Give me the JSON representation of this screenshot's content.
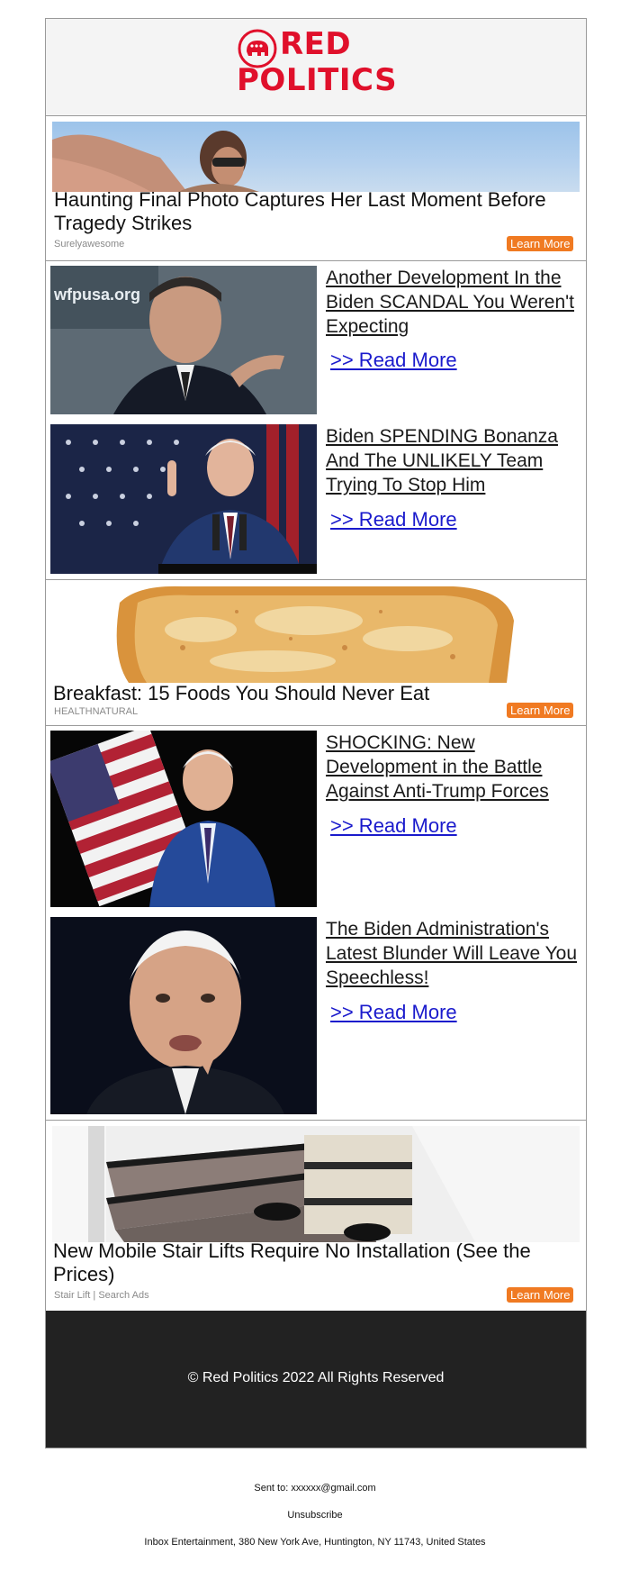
{
  "brand": {
    "line1": "RED",
    "line2": "POLITICS",
    "color": "#e0102b"
  },
  "sponsored": [
    {
      "title": "Haunting Final Photo Captures Her Last Moment Before Tragedy Strikes",
      "source": "Surelyawesome",
      "cta": "Learn More"
    },
    {
      "title": "Breakfast: 15 Foods You Should Never Eat",
      "source": "HEALTHNATURAL",
      "cta": "Learn More"
    },
    {
      "title": "New Mobile Stair Lifts Require No Installation (See the Prices)",
      "source": "Stair Lift | Search Ads",
      "cta": "Learn More"
    }
  ],
  "articles": [
    {
      "headline": "Another Development In the Biden SCANDAL You Weren't Expecting",
      "read_more": ">> Read More",
      "image_text": "wfpusa.org"
    },
    {
      "headline": "Biden SPENDING Bonanza And The UNLIKELY Team Trying To Stop Him",
      "read_more": ">> Read More"
    },
    {
      "headline": "SHOCKING: New Development in the Battle Against Anti-Trump Forces",
      "read_more": ">> Read More"
    },
    {
      "headline": "The Biden Administration's Latest Blunder Will Leave You Speechless!",
      "read_more": ">> Read More"
    }
  ],
  "footer": {
    "copyright": "© Red Politics 2022 All Rights Reserved"
  },
  "meta_footer": {
    "sent_to": "Sent to: xxxxxx@gmail.com",
    "unsubscribe": "Unsubscribe",
    "address": "Inbox Entertainment, 380 New York Ave, Huntington, NY 11743, United States"
  },
  "colors": {
    "accent": "#e0102b",
    "cta": "#f07a22",
    "link": "#1a1acc",
    "footer_bg": "#222222"
  }
}
